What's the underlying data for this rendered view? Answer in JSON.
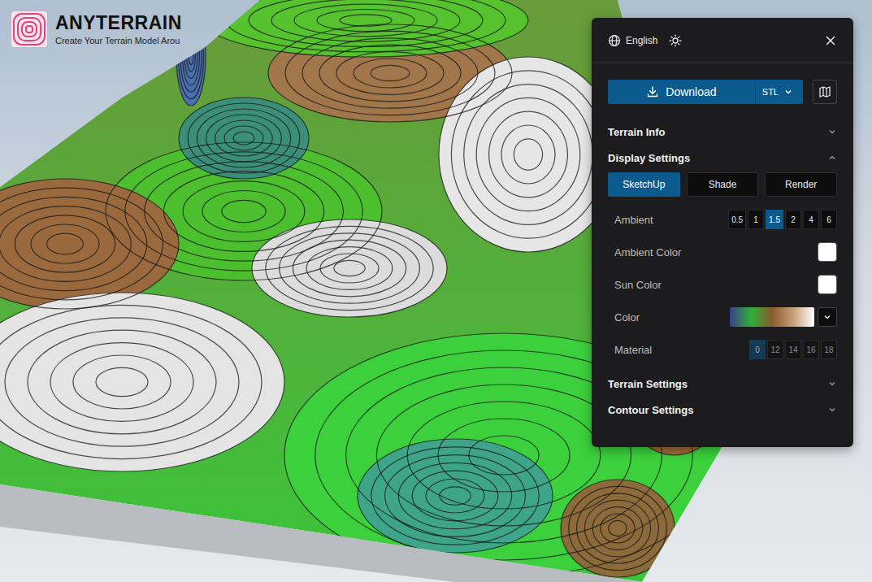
{
  "logo": {
    "title": "ANYTERRAIN",
    "subtitle": "Create Your Terrain Model Arou"
  },
  "panel": {
    "language": "English",
    "download": {
      "label": "Download",
      "format": "STL"
    },
    "sections": [
      {
        "title": "Terrain Info",
        "expanded": false
      },
      {
        "title": "Display Settings",
        "expanded": true,
        "modes": [
          {
            "label": "SketchUp",
            "selected": true
          },
          {
            "label": "Shade",
            "selected": false
          },
          {
            "label": "Render",
            "selected": false
          }
        ],
        "settings": [
          {
            "kind": "options",
            "label": "Ambient",
            "disabled": false,
            "options": [
              {
                "label": "0.5",
                "selected": false
              },
              {
                "label": "1",
                "selected": false
              },
              {
                "label": "1.5",
                "selected": true
              },
              {
                "label": "2",
                "selected": false
              },
              {
                "label": "4",
                "selected": false
              },
              {
                "label": "6",
                "selected": false
              }
            ]
          },
          {
            "kind": "swatch",
            "label": "Ambient Color",
            "color": "#ffffff"
          },
          {
            "kind": "swatch",
            "label": "Sun Color",
            "color": "#ffffff"
          },
          {
            "kind": "gradient",
            "label": "Color",
            "stops": [
              "#3a3f8c",
              "#2fae3a",
              "#8a5a2e",
              "#c8a07a",
              "#ffffff"
            ]
          },
          {
            "kind": "options",
            "label": "Material",
            "disabled": true,
            "options": [
              {
                "label": "0",
                "selected": true
              },
              {
                "label": "12",
                "selected": false
              },
              {
                "label": "14",
                "selected": false
              },
              {
                "label": "16",
                "selected": false
              },
              {
                "label": "18",
                "selected": false
              }
            ]
          }
        ]
      },
      {
        "title": "Terrain Settings",
        "expanded": false
      },
      {
        "title": "Contour Settings",
        "expanded": false
      }
    ]
  }
}
